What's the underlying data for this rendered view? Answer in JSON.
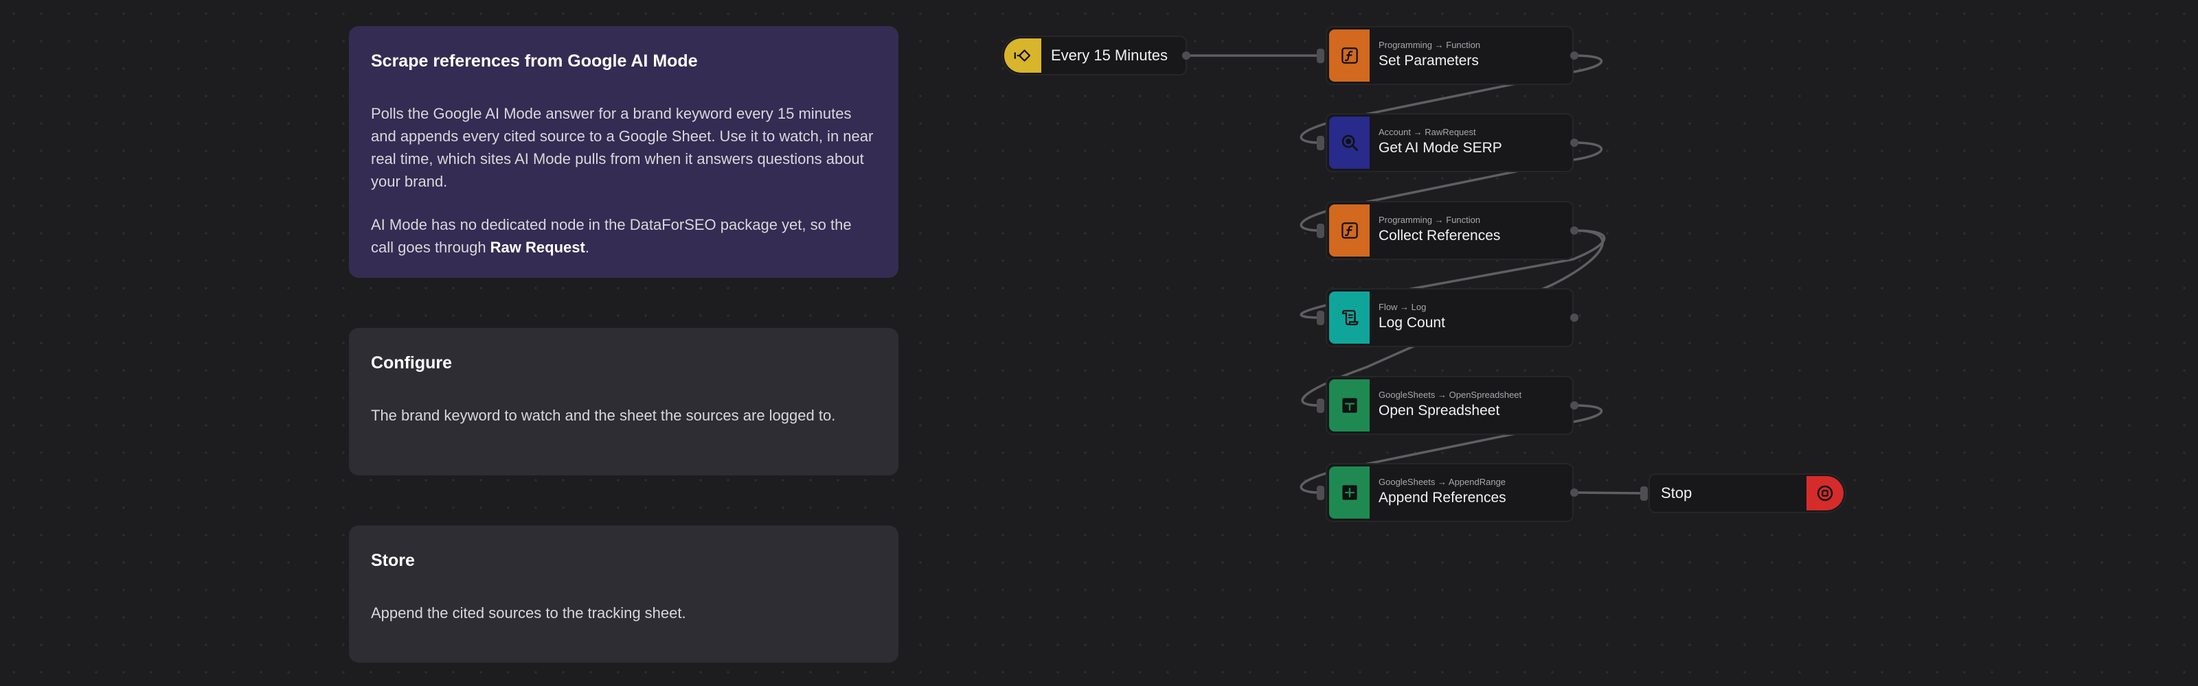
{
  "notes": {
    "main": {
      "title": "Scrape references from Google AI Mode",
      "para1": "Polls the Google AI Mode answer for a brand keyword every 15 minutes and appends every cited source to a Google Sheet. Use it to watch, in near real time, which sites AI Mode pulls from when it answers questions about your brand.",
      "para2_before": "AI Mode has no dedicated node in the DataForSEO package yet, so the call goes through ",
      "para2_bold": "Raw Request",
      "para2_after": "."
    },
    "configure": {
      "title": "Configure",
      "text": "The brand keyword to watch and the sheet the sources are logged to."
    },
    "store": {
      "title": "Store",
      "text": "Append the cited sources to the tracking sheet."
    }
  },
  "trigger": {
    "label": "Every 15 Minutes",
    "icon": "trigger-icon",
    "color": "#d9b52c"
  },
  "nodes": [
    {
      "category": "Programming → Function",
      "label": "Set Parameters",
      "icon": "function-icon",
      "color": "#d2691e"
    },
    {
      "category": "Account → RawRequest",
      "label": "Get AI Mode SERP",
      "icon": "search-icon",
      "color": "#282a8c"
    },
    {
      "category": "Programming → Function",
      "label": "Collect References",
      "icon": "function-icon",
      "color": "#d2691e"
    },
    {
      "category": "Flow → Log",
      "label": "Log Count",
      "icon": "scroll-icon",
      "color": "#10a59a"
    },
    {
      "category": "GoogleSheets → OpenSpreadsheet",
      "label": "Open Spreadsheet",
      "icon": "sheet-icon",
      "color": "#1e8a52"
    },
    {
      "category": "GoogleSheets → AppendRange",
      "label": "Append References",
      "icon": "sheet-icon",
      "color": "#1e8a52"
    }
  ],
  "stop": {
    "label": "Stop",
    "icon": "stop-icon",
    "color": "#d62b2b"
  }
}
